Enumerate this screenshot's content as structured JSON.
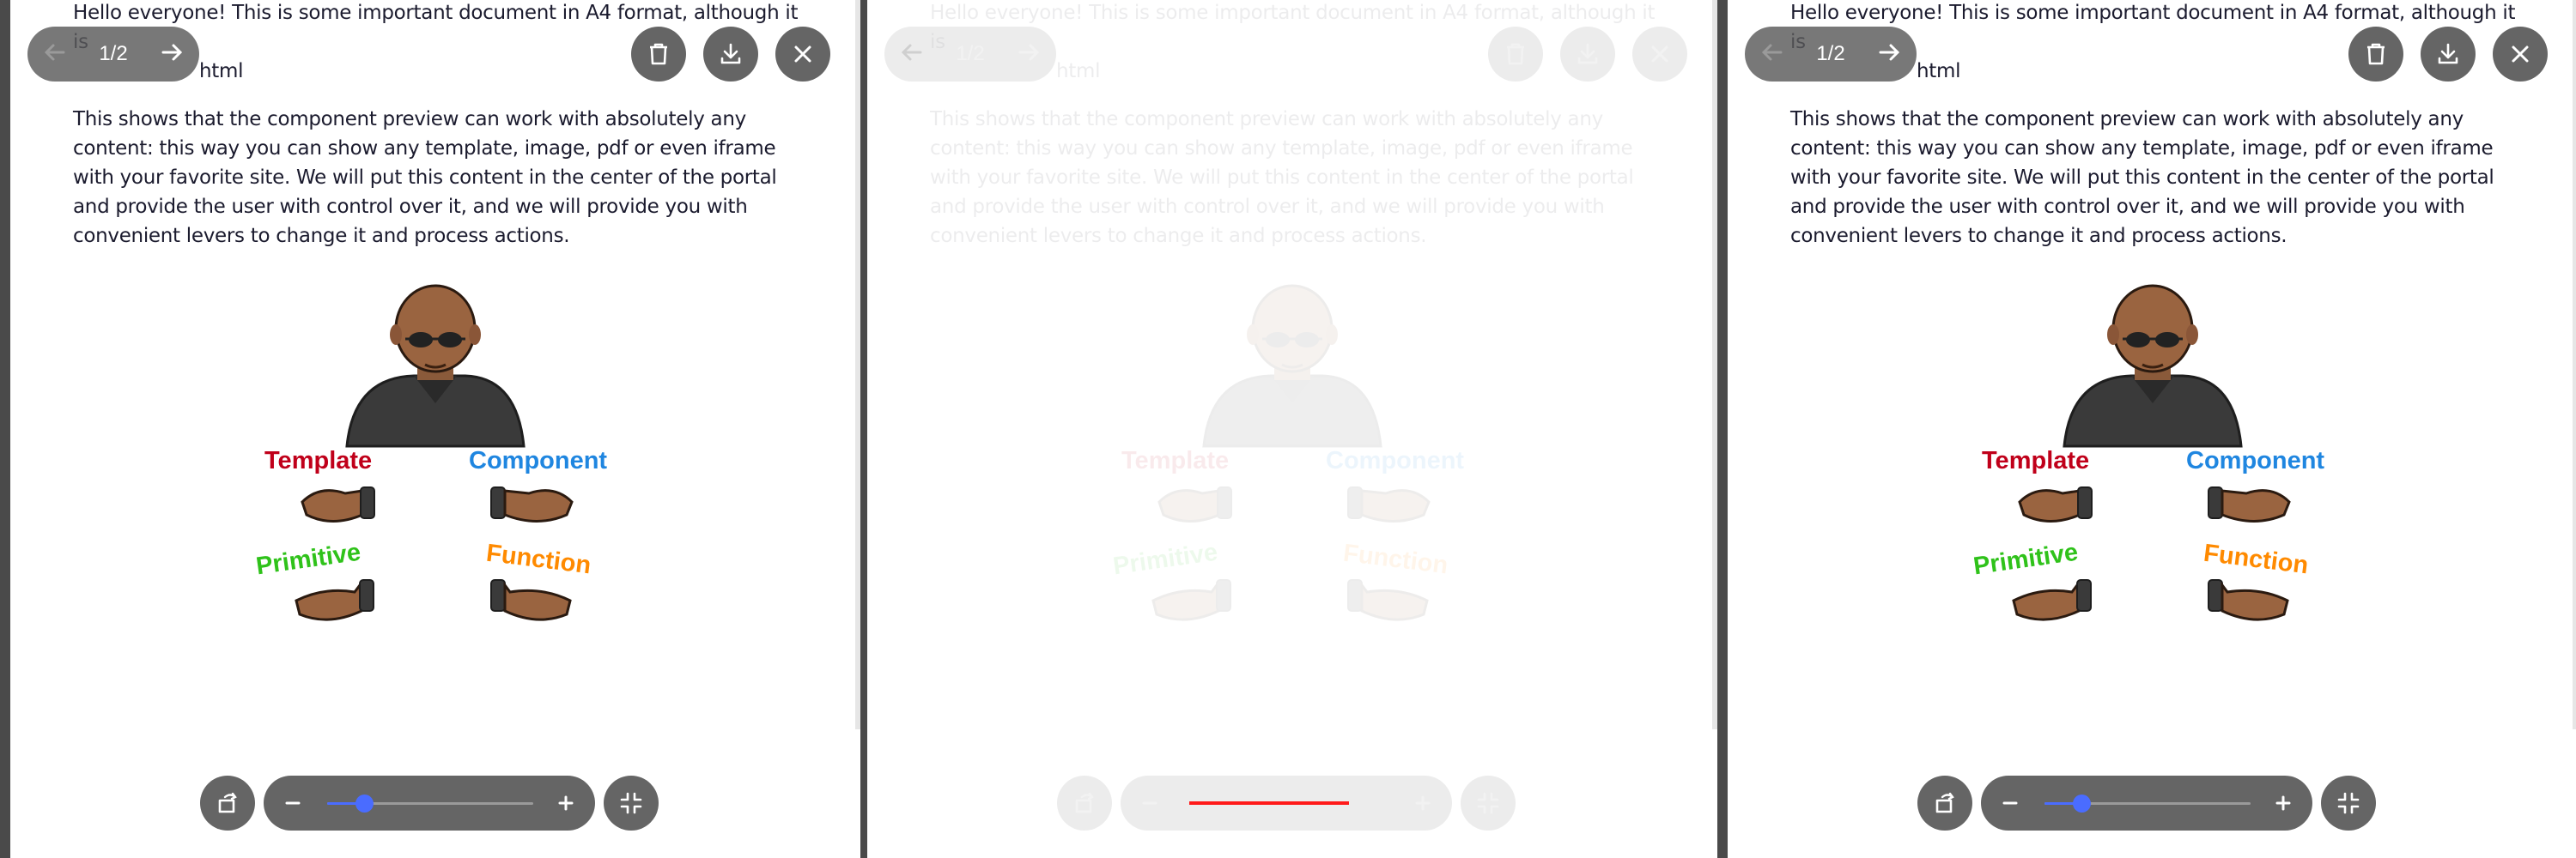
{
  "document": {
    "line1": "Hello everyone! This is some important document in A4 format, although it is",
    "line2": "html",
    "paragraph": "This shows that the component preview can work with absolutely any content: this way you can show any template, image, pdf or even iframe with your favorite site. We will put this content in the center of the portal and provide the user with control over it, and we will provide you with convenient levers to change it and process actions."
  },
  "figure": {
    "labels": {
      "template": "Template",
      "component": "Component",
      "primitive": "Primitive",
      "function": "Function"
    }
  },
  "pager": {
    "counter": "1/2"
  },
  "colors": {
    "template": "#c0001a",
    "component": "#1f86e0",
    "primitive": "#2fc21a",
    "function": "#ff8a00",
    "accent": "#4a6cff",
    "loader": "#ff1a1a"
  },
  "icons": [
    "arrow-left-icon",
    "arrow-right-icon",
    "trash-icon",
    "download-icon",
    "close-icon",
    "rotate-icon",
    "minus-icon",
    "plus-icon",
    "collapse-icon"
  ],
  "panels": [
    {
      "state": "ready",
      "zoom_level": 0.18
    },
    {
      "state": "loading"
    },
    {
      "state": "ready",
      "zoom_level": 0.18
    }
  ]
}
